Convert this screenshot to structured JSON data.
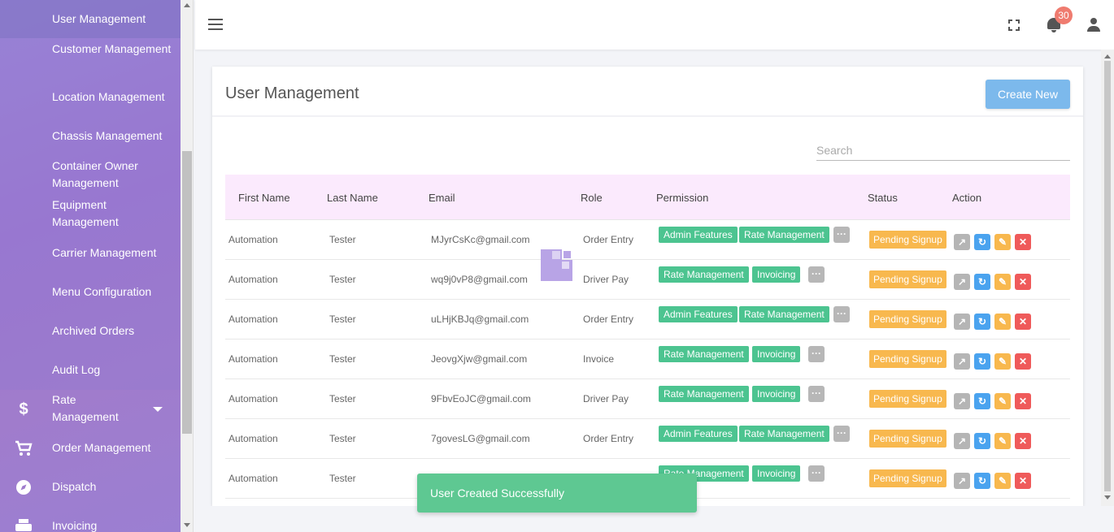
{
  "sidebar": {
    "sub_items": [
      {
        "label": "User Management",
        "active": true
      },
      {
        "label": "Customer Management"
      },
      {
        "label": "Location Management"
      },
      {
        "label": "Chassis Management"
      },
      {
        "label": "Container Owner Management"
      },
      {
        "label": "Equipment Management"
      },
      {
        "label": "Carrier Management"
      },
      {
        "label": "Menu Configuration"
      },
      {
        "label": "Archived Orders"
      },
      {
        "label": "Audit Log"
      }
    ],
    "main_items": [
      {
        "label": "Rate Management",
        "icon": "dollar-icon"
      },
      {
        "label": "Order Management",
        "icon": "cart-icon"
      },
      {
        "label": "Dispatch",
        "icon": "compass-icon"
      },
      {
        "label": "Invoicing",
        "icon": "printer-icon"
      }
    ]
  },
  "topbar": {
    "notification_count": "30"
  },
  "page": {
    "title": "User Management",
    "create_button": "Create New",
    "search_placeholder": "Search"
  },
  "table": {
    "headers": [
      "First Name",
      "Last Name",
      "Email",
      "Role",
      "Permission",
      "Status",
      "Action"
    ],
    "more_label": "···",
    "rows": [
      {
        "first": "Automation",
        "last": "Tester",
        "email": "MJyrCsKc@gmail.com",
        "role": "Order Entry",
        "permissions": [
          "Admin Features",
          "Rate Management"
        ],
        "status": "Pending Signup"
      },
      {
        "first": "Automation",
        "last": "Tester",
        "email": "wq9j0vP8@gmail.com",
        "role": "Driver Pay",
        "permissions": [
          "Rate Management",
          "Invoicing"
        ],
        "status": "Pending Signup"
      },
      {
        "first": "Automation",
        "last": "Tester",
        "email": "uLHjKBJq@gmail.com",
        "role": "Order Entry",
        "permissions": [
          "Admin Features",
          "Rate Management"
        ],
        "status": "Pending Signup"
      },
      {
        "first": "Automation",
        "last": "Tester",
        "email": "JeovgXjw@gmail.com",
        "role": "Invoice",
        "permissions": [
          "Rate Management",
          "Invoicing"
        ],
        "status": "Pending Signup"
      },
      {
        "first": "Automation",
        "last": "Tester",
        "email": "9FbvEoJC@gmail.com",
        "role": "Driver Pay",
        "permissions": [
          "Rate Management",
          "Invoicing"
        ],
        "status": "Pending Signup"
      },
      {
        "first": "Automation",
        "last": "Tester",
        "email": "7govesLG@gmail.com",
        "role": "Order Entry",
        "permissions": [
          "Admin Features",
          "Rate Management"
        ],
        "status": "Pending Signup"
      },
      {
        "first": "Automation",
        "last": "Tester",
        "email": "",
        "role": "",
        "permissions": [
          "Rate Management",
          "Invoicing"
        ],
        "status": "Pending Signup"
      }
    ]
  },
  "toast": {
    "message": "User Created Successfully"
  },
  "colors": {
    "sidebar": "#9d7fd2",
    "chip_green": "#4cc490",
    "status_orange": "#f8b84e",
    "create_blue": "#7cb9ec",
    "badge_red": "#ef7b6f",
    "toast_green": "#5ec892"
  }
}
